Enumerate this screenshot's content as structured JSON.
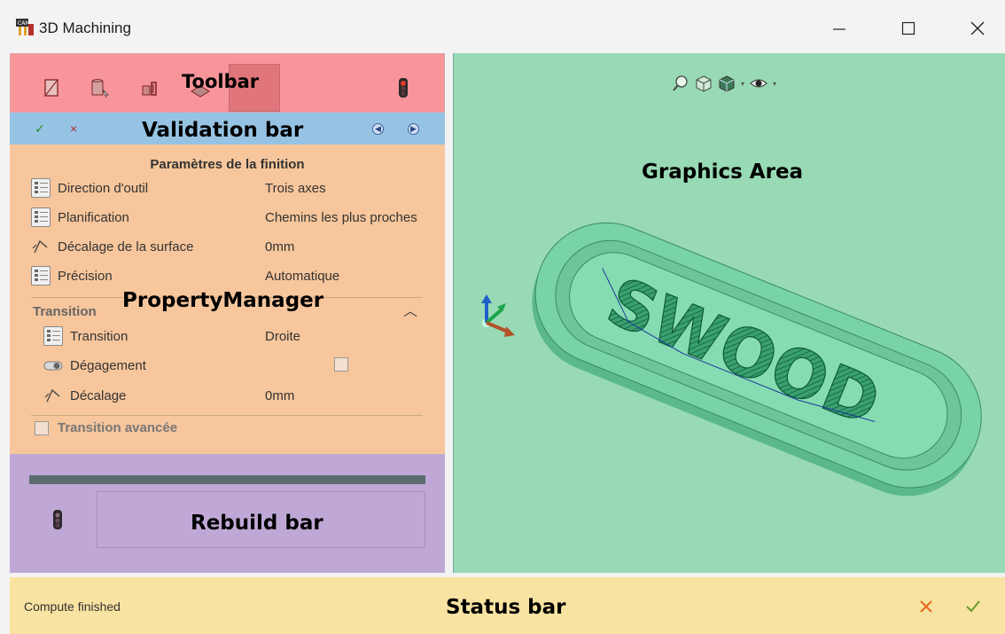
{
  "window": {
    "title": "3D Machining",
    "controls": [
      "minimize",
      "maximize",
      "close"
    ]
  },
  "overlay_labels": {
    "toolbar": "Toolbar",
    "validation": "Validation bar",
    "property_manager": "PropertyManager",
    "graphics": "Graphics Area",
    "rebuild": "Rebuild bar",
    "status": "Status bar"
  },
  "toolbar": {
    "icons": [
      "stock-icon",
      "tool-icon",
      "fixture-icon",
      "operation-icon",
      "traffic-light-icon"
    ]
  },
  "validation_bar": {
    "ok": "✓",
    "cancel": "×"
  },
  "property_manager": {
    "heading": "Paramètres de la finition",
    "rows": [
      {
        "label": "Direction d'outil",
        "value": "Trois axes",
        "icon": "list-icon"
      },
      {
        "label": "Planification",
        "value": "Chemins les plus proches",
        "icon": "list-icon"
      },
      {
        "label": "Décalage de la surface",
        "value": "0mm",
        "icon": "offset-icon"
      },
      {
        "label": "Précision",
        "value": "Automatique",
        "icon": "list-icon"
      }
    ],
    "transition_group": {
      "title": "Transition",
      "rows": [
        {
          "label": "Transition",
          "value": "Droite",
          "icon": "list-icon"
        },
        {
          "label": "Dégagement",
          "value": "",
          "icon": "toggle-icon"
        },
        {
          "label": "Décalage",
          "value": "0mm",
          "icon": "offset-icon"
        }
      ]
    },
    "advanced_transition": "Transition avancée"
  },
  "status": {
    "text": "Compute finished"
  },
  "colors": {
    "toolbar": "#f8959a",
    "validation": "#96c3e3",
    "property_manager": "#f7c69c",
    "rebuild": "#c0a8d6",
    "graphics": "#98dab5",
    "status": "#f9e3a2"
  }
}
